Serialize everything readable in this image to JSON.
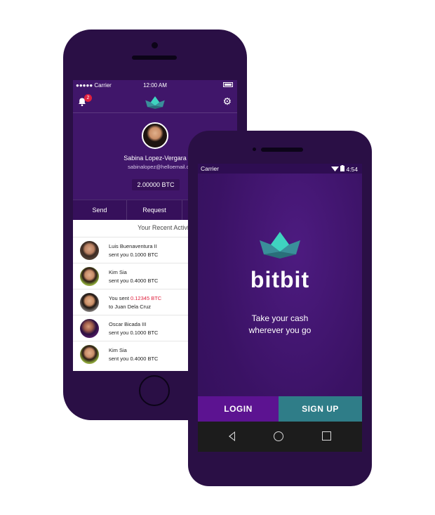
{
  "iphone": {
    "status": {
      "carrier": "●●●●● Carrier",
      "time": "12:00 AM"
    },
    "notification_count": "2",
    "profile": {
      "name": "Sabina Lopez-Vergara",
      "email": "sabinalopez@helloemail.com",
      "balance": "2.00000 BTC"
    },
    "actions": {
      "send": "Send",
      "request": "Request"
    },
    "activity_title": "Your Recent Activity",
    "activity": [
      {
        "name": "Luis Buenaventura II",
        "desc_prefix": "sent you ",
        "amount": "0.1000 BTC"
      },
      {
        "name": "Kim Sia",
        "desc_prefix": "sent you ",
        "amount": "0.4000 BTC"
      },
      {
        "name_prefix": "You sent ",
        "name_amount": "0.12345 BTC",
        "desc_prefix": "to ",
        "recipient": "Juan Dela Cruz"
      },
      {
        "name": "Oscar Bicada III",
        "desc_prefix": "sent you ",
        "amount": "0.1000 BTC"
      },
      {
        "name": "Kim Sia",
        "desc_prefix": "sent you ",
        "amount": "0.4000 BTC"
      }
    ]
  },
  "android": {
    "status": {
      "carrier": "Carrier",
      "time": "4:54"
    },
    "brand": "bitbit",
    "tagline_line1": "Take your cash",
    "tagline_line2": "wherever you go",
    "login_label": "LOGIN",
    "signup_label": "SIGN UP"
  },
  "colors": {
    "brand_purple": "#40166a",
    "login": "#5c1391",
    "signup": "#2f7d88",
    "logo_teal": "#3fd3c0",
    "alert_red": "#e0213e"
  },
  "icons": [
    "bell-icon",
    "gear-icon",
    "wifi-icon",
    "battery-icon",
    "back-icon",
    "home-icon",
    "recents-icon"
  ]
}
